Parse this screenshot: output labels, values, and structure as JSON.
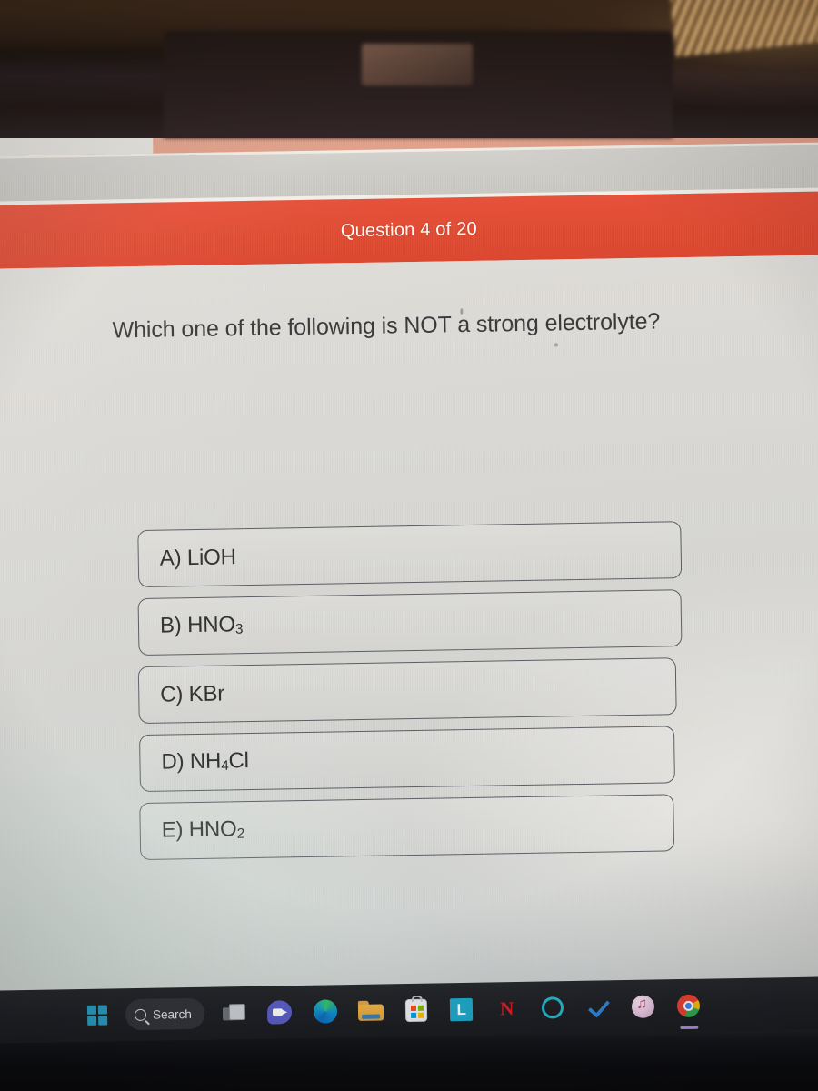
{
  "browser": {
    "tab_close_label": "×",
    "new_tab_label": "+"
  },
  "quiz": {
    "banner": "Question 4 of 20",
    "question": "Which one of the following is NOT a strong electrolyte?",
    "banner_color": "#e04b33",
    "options": [
      {
        "id": "A",
        "text": "A) LiOH",
        "formula_html": "A) LiOH"
      },
      {
        "id": "B",
        "text": "B) HNO3",
        "formula_html": "B) HNO3"
      },
      {
        "id": "C",
        "text": "C) KBr",
        "formula_html": "C) KBr"
      },
      {
        "id": "D",
        "text": "D) NH4Cl",
        "formula_html": "D) NH4Cl"
      },
      {
        "id": "E",
        "text": "E) HNO2",
        "formula_html": "E) HNO2"
      }
    ]
  },
  "taskbar": {
    "start_label": "Start",
    "search_label": "Search",
    "items": [
      {
        "name": "task-view",
        "label": "Task View"
      },
      {
        "name": "teams",
        "label": "Chat"
      },
      {
        "name": "edge",
        "label": "Microsoft Edge"
      },
      {
        "name": "file-explorer",
        "label": "File Explorer"
      },
      {
        "name": "microsoft-store",
        "label": "Microsoft Store"
      },
      {
        "name": "lightshot",
        "label": "L"
      },
      {
        "name": "netflix",
        "label": "N"
      },
      {
        "name": "alexa",
        "label": "Alexa"
      },
      {
        "name": "todo-check",
        "label": "Tasks"
      },
      {
        "name": "itunes",
        "label": "iTunes"
      },
      {
        "name": "chrome",
        "label": "Google Chrome"
      }
    ]
  }
}
